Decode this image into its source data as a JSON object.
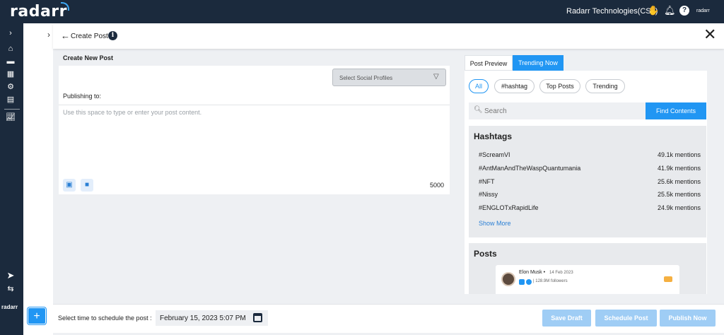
{
  "header": {
    "logo": "radarr",
    "org_name": "Radarr Technologies(CS1)",
    "brand_small": "radarr"
  },
  "sidebar": {
    "brand": "radarr",
    "fab_label": "+"
  },
  "title_bar": {
    "back_glyph": "←",
    "title": "Create Post",
    "info_glyph": "i",
    "close_glyph": "✕"
  },
  "compose": {
    "section_title": "Create New Post",
    "select_profiles_label": "Select Social Profiles",
    "publishing_label": "Publishing to:",
    "placeholder": "Use this space to type or enter your post content.",
    "value": "",
    "char_count": "5000"
  },
  "right": {
    "tabs": [
      {
        "label": "Post Preview"
      },
      {
        "label": "Trending Now"
      }
    ],
    "filters": [
      {
        "label": "All"
      },
      {
        "label": "#hashtag"
      },
      {
        "label": "Top Posts"
      },
      {
        "label": "Trending"
      }
    ],
    "search_placeholder": "Search",
    "find_label": "Find Contents",
    "hashtags_title": "Hashtags",
    "hashtags": [
      {
        "tag": "#ScreamVI",
        "count": "49.1k mentions"
      },
      {
        "tag": "#AntManAndTheWaspQuantumania",
        "count": "41.9k mentions"
      },
      {
        "tag": "#NFT",
        "count": "25.6k mentions"
      },
      {
        "tag": "#Nissy",
        "count": "25.5k mentions"
      },
      {
        "tag": "#ENGLOTxRapidLife",
        "count": "24.9k mentions"
      }
    ],
    "show_more": "Show More",
    "posts_title": "Posts",
    "post": {
      "author": "Elon Musk •",
      "date": "14 Feb 2023",
      "followers": "| 128.9M followers"
    }
  },
  "footer": {
    "schedule_label": "Select time to schedule the post :",
    "date_value": "February 15, 2023 5:07 PM",
    "save_draft": "Save Draft",
    "schedule_post": "Schedule Post",
    "publish_now": "Publish Now"
  }
}
